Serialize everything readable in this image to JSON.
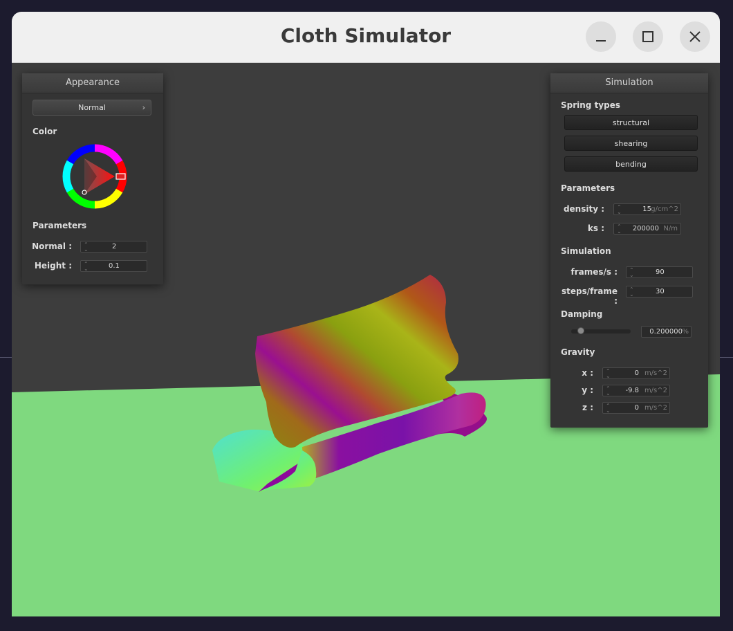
{
  "window": {
    "title": "Cloth Simulator",
    "controls": [
      "minimize-icon",
      "maximize-icon",
      "close-icon"
    ]
  },
  "colors": {
    "floor": "#7fd97f",
    "background": "#3d3d3d",
    "panel": "#343434",
    "titlebar": "#f0f0f0"
  },
  "appearance": {
    "title": "Appearance",
    "shader": "Normal",
    "color_label": "Color",
    "params_label": "Parameters",
    "normal_label": "Normal :",
    "normal_value": "2",
    "height_label": "Height :",
    "height_value": "0.1"
  },
  "simulation": {
    "title": "Simulation",
    "spring_types_label": "Spring types",
    "spring_buttons": [
      "structural",
      "shearing",
      "bending"
    ],
    "params_label": "Parameters",
    "density_label": "density :",
    "density_value": "15",
    "density_unit": "g/cm^2",
    "ks_label": "ks :",
    "ks_value": "200000",
    "ks_unit": "N/m",
    "sim_label": "Simulation",
    "fps_label": "frames/s :",
    "fps_value": "90",
    "steps_label": "steps/frame :",
    "steps_value": "30",
    "damping_label": "Damping",
    "damping_value": "0.200000",
    "damping_unit": "%",
    "damping_slider_fraction": 0.2,
    "gravity_label": "Gravity",
    "gx_label": "x :",
    "gx_value": "0",
    "gy_label": "y :",
    "gy_value": "-9.8",
    "gz_label": "z :",
    "gz_value": "0",
    "gravity_unit": "m/s^2"
  }
}
